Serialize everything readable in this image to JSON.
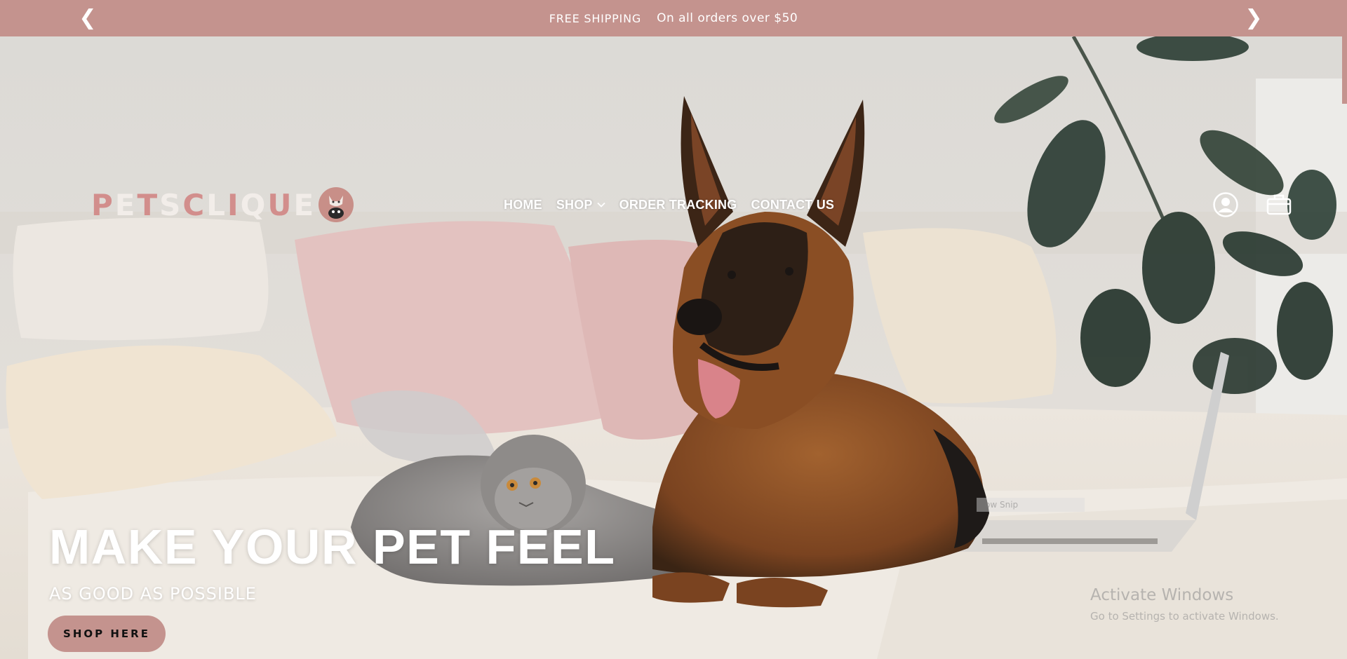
{
  "announcement": {
    "heading": "FREE SHIPPING",
    "message": "On all orders over $50",
    "prev_symbol": "❮",
    "next_symbol": "❯"
  },
  "brand": {
    "letters": [
      "P",
      "E",
      "T",
      "S",
      "C",
      "L",
      "I",
      "Q",
      "U",
      "E"
    ],
    "letter_colors": [
      "#d28e8c",
      "#f2ede9",
      "#d28e8c",
      "#f2ede9",
      "#d28e8c",
      "#f2ede9",
      "#d28e8c",
      "#f2ede9",
      "#d28e8c",
      "#f2ede9"
    ],
    "accent": "#c4938e"
  },
  "nav": {
    "items": [
      {
        "label": "HOME",
        "has_dropdown": false
      },
      {
        "label": "SHOP",
        "has_dropdown": true
      },
      {
        "label": "ORDER TRACKING",
        "has_dropdown": false
      },
      {
        "label": "CONTACT US",
        "has_dropdown": false
      }
    ]
  },
  "header_icons": {
    "account": "account-icon",
    "cart": "cart-icon"
  },
  "hero": {
    "title": "MAKE YOUR PET FEEL",
    "subtitle": "AS GOOD AS POSSIBLE",
    "cta_label": "SHOP HERE"
  },
  "overlay": {
    "snip_text": "ow Snip",
    "watermark_title": "Activate Windows",
    "watermark_sub": "Go to Settings to activate Windows."
  }
}
